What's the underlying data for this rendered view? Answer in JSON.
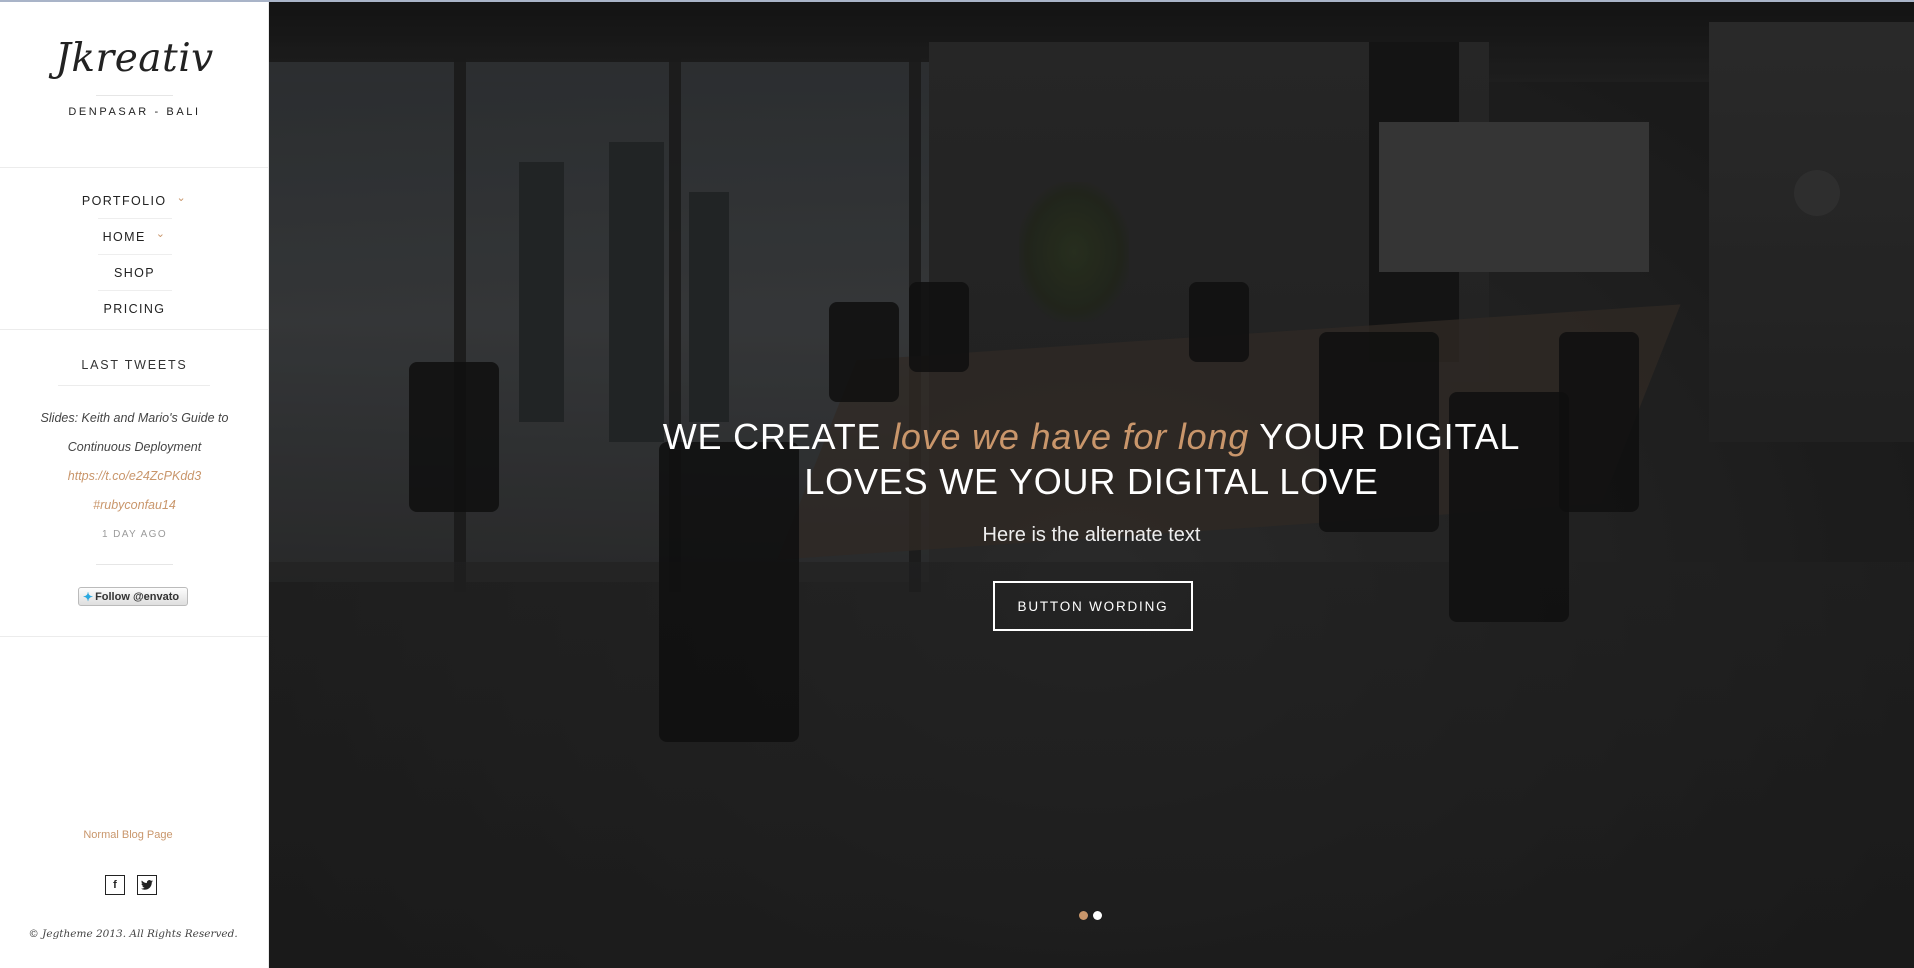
{
  "brand": {
    "name": "Jkreativ",
    "tagline": "DENPASAR - BALI"
  },
  "nav": {
    "items": [
      {
        "label": "PORTFOLIO",
        "has_dropdown": true
      },
      {
        "label": "HOME",
        "has_dropdown": true
      },
      {
        "label": "SHOP",
        "has_dropdown": false
      },
      {
        "label": "PRICING",
        "has_dropdown": false
      }
    ],
    "caret_icon": "chevron-down-icon"
  },
  "tweets": {
    "title": "LAST TWEETS",
    "text": "Slides: Keith and Mario's Guide to Continuous Deployment",
    "link": "https://t.co/e24ZcPKdd3",
    "hashtag": "#rubyconfau14",
    "time": "1 DAY AGO",
    "follow_label": "Follow @envato"
  },
  "footer": {
    "blog_link": "Normal Blog Page",
    "social": [
      {
        "icon": "facebook-icon",
        "glyph": "f"
      },
      {
        "icon": "twitter-icon",
        "glyph": "t"
      }
    ],
    "copyright": "© Jegtheme 2013. All Rights Reserved."
  },
  "hero": {
    "headline_part1": "WE CREATE ",
    "headline_accent": "love we have for long",
    "headline_part2": " YOUR DIGITAL",
    "headline_line2": "LOVES WE YOUR DIGITAL LOVE",
    "subtext": "Here is the alternate text",
    "button_label": "BUTTON WORDING",
    "slide_count": 2,
    "active_slide": 1
  },
  "colors": {
    "accent": "#c9966b",
    "dot_active": "#c9966b",
    "dot_inactive": "#ffffff"
  }
}
